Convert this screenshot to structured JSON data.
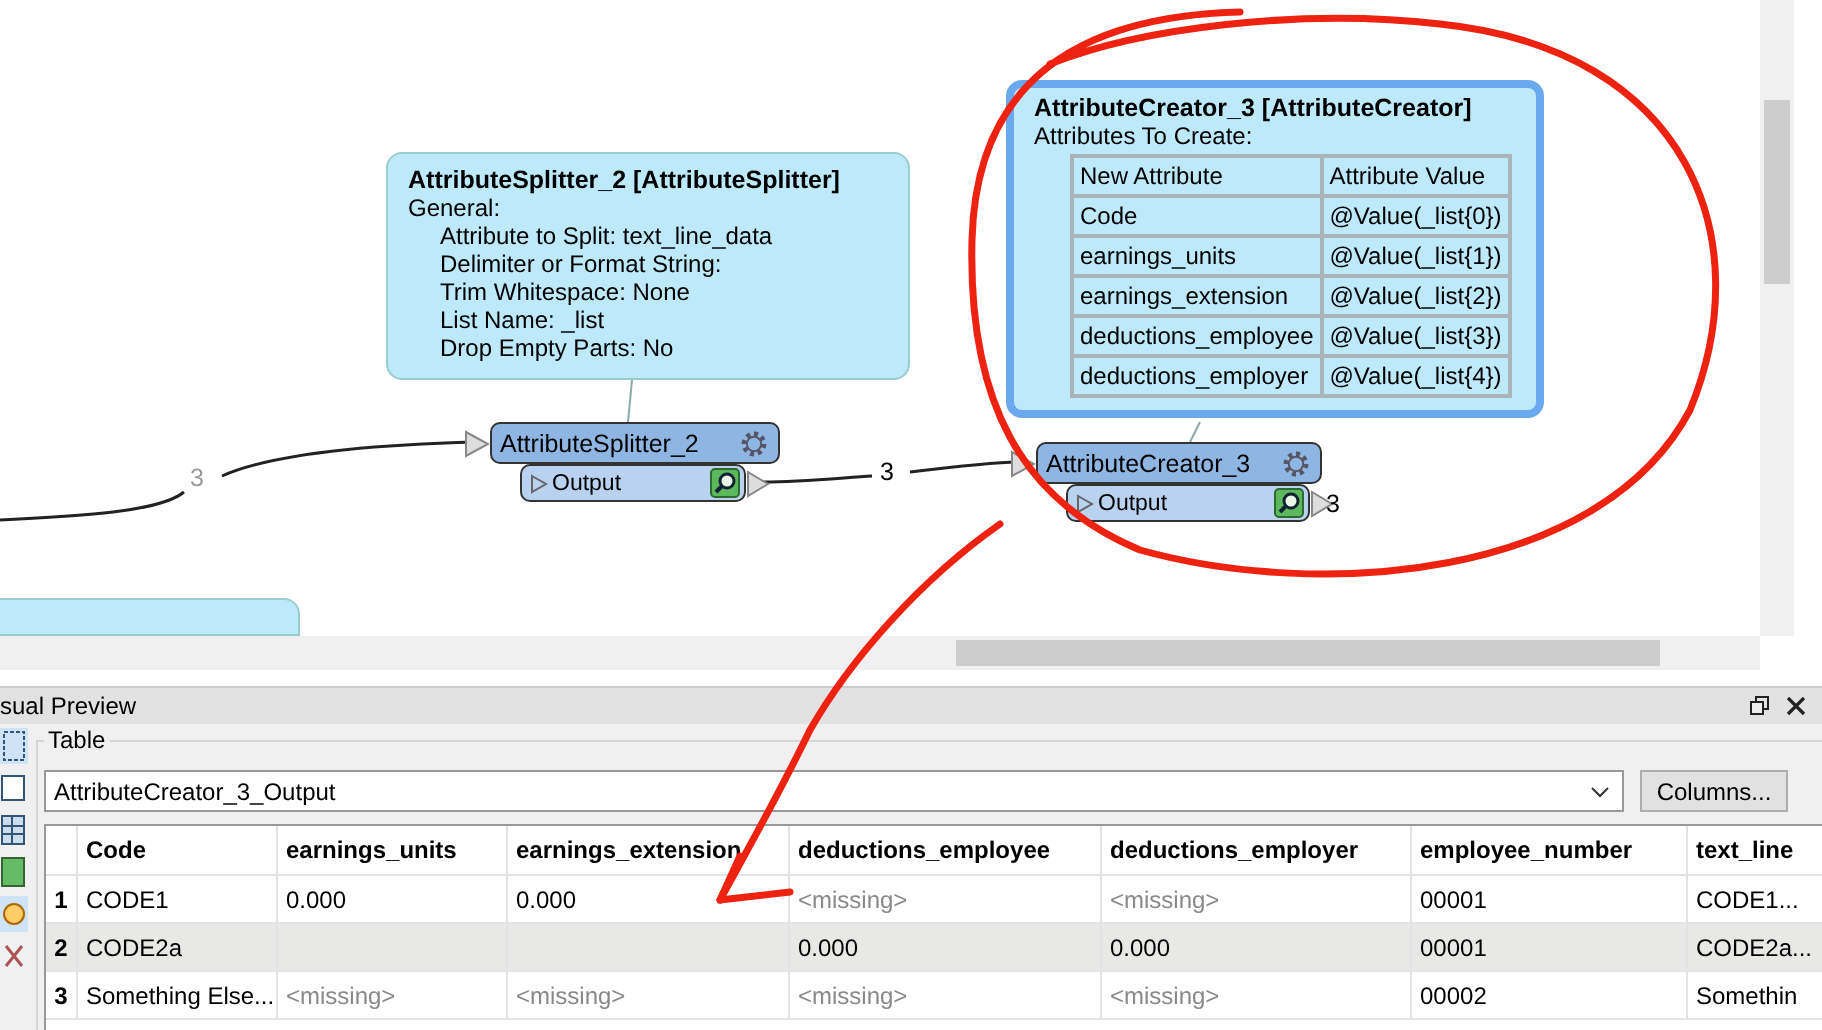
{
  "canvas": {
    "annotations": [
      {
        "kind": "parameters",
        "selected": false,
        "title": "AttributeSplitter_2 [AttributeSplitter]",
        "heading": "General:",
        "items": [
          "Attribute to Split: text_line_data",
          "Delimiter or Format String:",
          "Trim Whitespace: None",
          "List Name: _list",
          "Drop Empty Parts: No"
        ]
      },
      {
        "kind": "attribute_table",
        "selected": true,
        "title": "AttributeCreator_3 [AttributeCreator]",
        "heading": "Attributes To Create:",
        "columns": [
          "New Attribute",
          "Attribute Value"
        ],
        "rows": [
          [
            "Code",
            "@Value(_list{0})"
          ],
          [
            "earnings_units",
            "@Value(_list{1})"
          ],
          [
            "earnings_extension",
            "@Value(_list{2})"
          ],
          [
            "deductions_employee",
            "@Value(_list{3})"
          ],
          [
            "deductions_employer",
            "@Value(_list{4})"
          ]
        ]
      }
    ],
    "transformers": [
      {
        "name": "AttributeSplitter_2",
        "port": "Output"
      },
      {
        "name": "AttributeCreator_3",
        "port": "Output"
      }
    ],
    "connections": [
      {
        "count": "3",
        "dimmed": true
      },
      {
        "count": "3",
        "dimmed": false
      },
      {
        "count": "3",
        "dimmed": false
      }
    ]
  },
  "preview": {
    "title": "sual Preview",
    "group_label": "Table",
    "dataset": "AttributeCreator_3_Output",
    "columns_button": "Columns...",
    "columns": [
      "Code",
      "earnings_units",
      "earnings_extension",
      "deductions_employee",
      "deductions_employer",
      "employee_number",
      "text_line"
    ],
    "rows": [
      {
        "number": "1",
        "selected": false,
        "cells": [
          {
            "text": "CODE1",
            "missing": false
          },
          {
            "text": "0.000",
            "missing": false
          },
          {
            "text": "0.000",
            "missing": false
          },
          {
            "text": "<missing>",
            "missing": true
          },
          {
            "text": "<missing>",
            "missing": true
          },
          {
            "text": "00001",
            "missing": false
          },
          {
            "text": "CODE1...",
            "missing": false
          }
        ]
      },
      {
        "number": "2",
        "selected": true,
        "cells": [
          {
            "text": "CODE2a",
            "missing": false
          },
          null,
          null,
          {
            "text": "0.000",
            "missing": false
          },
          {
            "text": "0.000",
            "missing": false
          },
          {
            "text": "00001",
            "missing": false
          },
          {
            "text": "CODE2a...",
            "missing": false
          }
        ]
      },
      {
        "number": "3",
        "selected": false,
        "cells": [
          {
            "text": "Something Else...",
            "missing": false
          },
          {
            "text": "<missing>",
            "missing": true
          },
          {
            "text": "<missing>",
            "missing": true
          },
          {
            "text": "<missing>",
            "missing": true
          },
          {
            "text": "<missing>",
            "missing": true
          },
          {
            "text": "00002",
            "missing": false
          },
          {
            "text": "Somethin",
            "missing": false
          }
        ]
      }
    ]
  }
}
